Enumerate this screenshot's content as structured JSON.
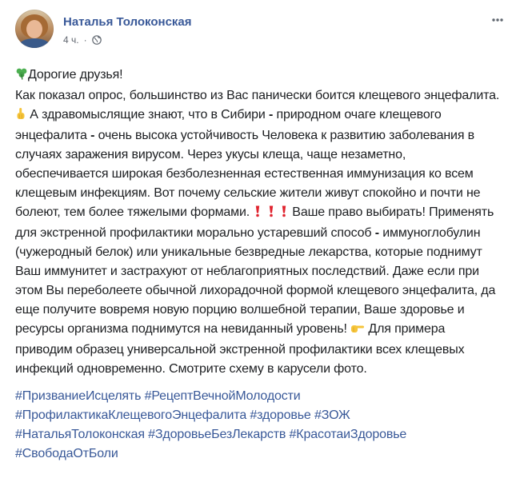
{
  "author": {
    "name": "Наталья Толоконская",
    "avatar": "avatar-photo"
  },
  "meta": {
    "time": "4 ч.",
    "separator": "·",
    "audience_icon": "globe-icon"
  },
  "post": {
    "greeting": "Дорогие друзья!",
    "greeting_icon": "clover-icon",
    "para1_a": "Как показал опрос, большинство из Вас панически боится клещевого энцефалита.",
    "finger_icon": "pointing-up-icon",
    "para1_b": "А здравомыслящие знают, что в Сибири",
    "dash1": "-",
    "para1_c": "природном очаге клещевого энцефалита",
    "dash2": "-",
    "para1_d": "очень высока устойчивость Человека к развитию заболевания в случаях заражения вирусом. Через укусы клеща, чаще незаметно, обеспечивается широкая безболезненная естественная иммунизация ко всем клещевым инфекциям. Вот почему сельские жители живут спокойно и почти не болеют, тем более тяжелыми формами.",
    "exclaim_icon": "red-exclamation-icon",
    "para2_a": "Ваше право выбирать! Применять для экстренной профилактики морально устаревший способ",
    "dash3": "-",
    "para2_b": "иммуноглобулин (чужеродный белок) или уникальные безвредные лекарства, которые поднимут Ваш иммунитет и застрахуют от неблагоприятных последствий. Даже если при этом Вы переболеете обычной лихорадочной формой клещевого энцефалита, да еще получите вовремя новую порцию волшебной терапии, Ваше здоровье и ресурсы организма поднимутся на невиданный уровень!",
    "pointing_icon": "pointing-right-icon",
    "para2_c": "Для примера приводим образец универсальной экстренной профилактики всех клещевых инфекций одновременно. Смотрите схему в карусели фото."
  },
  "hashtags": [
    "#ПризваниеИсцелять",
    "#РецептВечнойМолодости",
    "#ПрофилактикаКлещевогоЭнцефалита",
    "#здоровье",
    "#ЗОЖ",
    "#НатальяТолоконская",
    "#ЗдоровьеБезЛекарств",
    "#КрасотаиЗдоровье",
    "#СвободаОтБоли"
  ],
  "colors": {
    "link": "#385898",
    "text": "#1c1e21",
    "meta": "#616770",
    "clover": "#4caf50",
    "exclaim": "#e0242f",
    "hand": "#f5c43b"
  }
}
